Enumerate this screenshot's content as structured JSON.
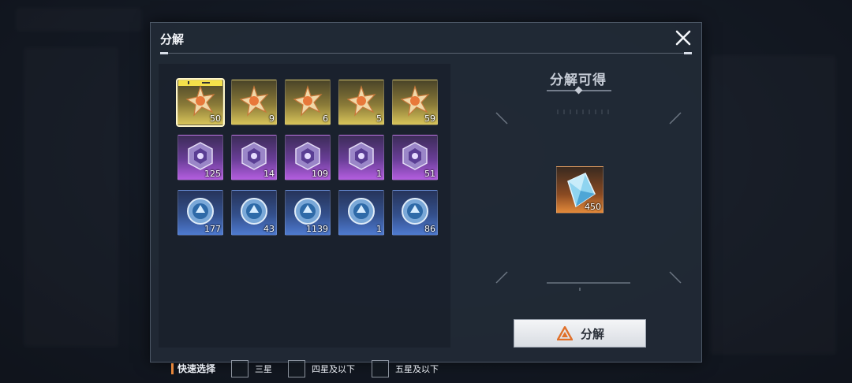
{
  "dialog": {
    "title": "分解",
    "yield_title": "分解可得",
    "decompose_label": "分解"
  },
  "items": [
    {
      "rarity": "gold",
      "count": "50",
      "icon": "star-emblem-icon",
      "selected": true
    },
    {
      "rarity": "gold",
      "count": "9",
      "icon": "star-emblem-icon"
    },
    {
      "rarity": "gold",
      "count": "6",
      "icon": "star-emblem-icon"
    },
    {
      "rarity": "gold",
      "count": "5",
      "icon": "star-emblem-icon"
    },
    {
      "rarity": "gold",
      "count": "59",
      "icon": "star-emblem-icon"
    },
    {
      "rarity": "purple",
      "count": "125",
      "icon": "hex-emblem-icon"
    },
    {
      "rarity": "purple",
      "count": "14",
      "icon": "hex-emblem-icon"
    },
    {
      "rarity": "purple",
      "count": "109",
      "icon": "hex-emblem-icon"
    },
    {
      "rarity": "purple",
      "count": "1",
      "icon": "hex-emblem-icon"
    },
    {
      "rarity": "purple",
      "count": "51",
      "icon": "hex-emblem-icon"
    },
    {
      "rarity": "blue",
      "count": "177",
      "icon": "round-emblem-icon"
    },
    {
      "rarity": "blue",
      "count": "43",
      "icon": "round-emblem-icon"
    },
    {
      "rarity": "blue",
      "count": "1139",
      "icon": "round-emblem-icon"
    },
    {
      "rarity": "blue",
      "count": "1",
      "icon": "round-emblem-icon"
    },
    {
      "rarity": "blue",
      "count": "86",
      "icon": "round-emblem-icon"
    }
  ],
  "reward": {
    "count": "450",
    "icon": "crystal-icon"
  },
  "quick_select": {
    "label": "快速选择",
    "options": [
      "三星",
      "四星及以下",
      "五星及以下"
    ]
  },
  "colors": {
    "gold": "#d8c45a",
    "purple": "#b45ee0",
    "blue": "#4e7ad0",
    "accent": "#e6863a"
  }
}
